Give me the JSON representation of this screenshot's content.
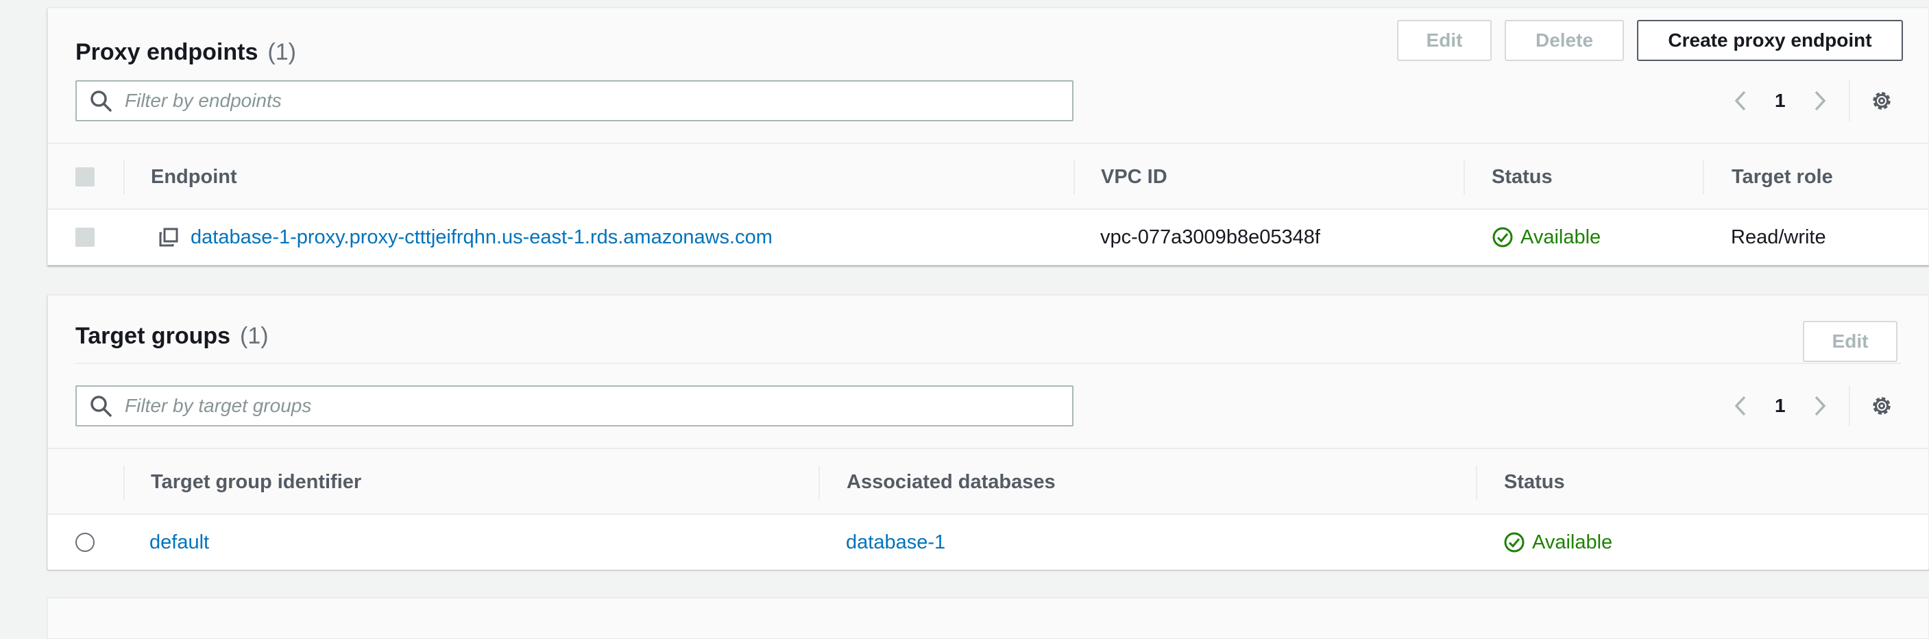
{
  "proxy_endpoints": {
    "title": "Proxy endpoints",
    "count": "(1)",
    "buttons": {
      "edit": "Edit",
      "delete": "Delete",
      "create": "Create proxy endpoint"
    },
    "filter_placeholder": "Filter by endpoints",
    "pagination": {
      "page": "1"
    },
    "columns": [
      "Endpoint",
      "VPC ID",
      "Status",
      "Target role"
    ],
    "rows": [
      {
        "endpoint": "database-1-proxy.proxy-ctttjeifrqhn.us-east-1.rds.amazonaws.com",
        "vpc_id": "vpc-077a3009b8e05348f",
        "status": "Available",
        "target_role": "Read/write"
      }
    ]
  },
  "target_groups": {
    "title": "Target groups",
    "count": "(1)",
    "buttons": {
      "edit": "Edit"
    },
    "filter_placeholder": "Filter by target groups",
    "pagination": {
      "page": "1"
    },
    "columns": [
      "Target group identifier",
      "Associated databases",
      "Status"
    ],
    "rows": [
      {
        "identifier": "default",
        "database": "database-1",
        "status": "Available"
      }
    ]
  },
  "colors": {
    "link": "#0073bb",
    "success": "#1d8102",
    "disabled_text": "#aab7b8",
    "header_text": "#545b64"
  },
  "icons": [
    "search-icon",
    "chevron-left-icon",
    "chevron-right-icon",
    "gear-icon",
    "copy-icon",
    "check-circle-icon"
  ]
}
